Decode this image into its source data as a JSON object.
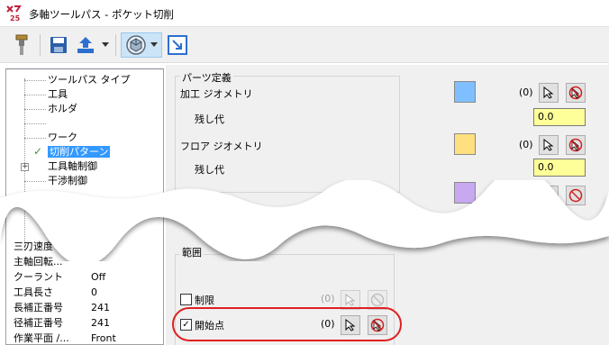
{
  "window": {
    "title": "多軸ツールパス - ポケット切削"
  },
  "toolbar": {
    "buttons": [
      "tool-icon",
      "save-icon",
      "export-icon",
      "view-cube-icon",
      "resize-icon"
    ]
  },
  "tree": {
    "items": [
      {
        "label": "ツールパス タイプ"
      },
      {
        "label": "工具"
      },
      {
        "label": "ホルダ"
      },
      {
        "label": ""
      },
      {
        "label": "ワーク"
      },
      {
        "label": "切削パターン",
        "selected": true,
        "checked": true
      },
      {
        "label": "工具軸制御",
        "expandable": true
      },
      {
        "label": "干渉制御"
      }
    ]
  },
  "props": [
    {
      "label": "三刃速度",
      "value": ""
    },
    {
      "label": "主軸回転...",
      "value": ""
    },
    {
      "label": "クーラント",
      "value": "Off"
    },
    {
      "label": "工具長さ",
      "value": "0"
    },
    {
      "label": "長補正番号",
      "value": "241"
    },
    {
      "label": "径補正番号",
      "value": "241"
    },
    {
      "label": "作業平面 /...",
      "value": "Front"
    }
  ],
  "parts": {
    "group_title": "パーツ定義",
    "machining_geometry": {
      "label": "加工 ジオメトリ",
      "count": "(0)",
      "color": "#7fbfff",
      "allowance_label": "残し代",
      "allowance_value": "0.0"
    },
    "floor_geometry": {
      "label": "フロア ジオメトリ",
      "count": "(0)",
      "color": "#ffe080",
      "allowance_label": "残し代",
      "allowance_value": "0.0"
    },
    "third_color": "#c8a8f0"
  },
  "range": {
    "group_title": "範囲",
    "limit": {
      "label": "制限",
      "count": "(0)",
      "checked": false
    },
    "start_point": {
      "label": "開始点",
      "count": "(0)",
      "checked": true
    }
  },
  "colors": {
    "highlight": "#e02020",
    "selection": "#3399ff",
    "input_bg": "#ffff99"
  }
}
